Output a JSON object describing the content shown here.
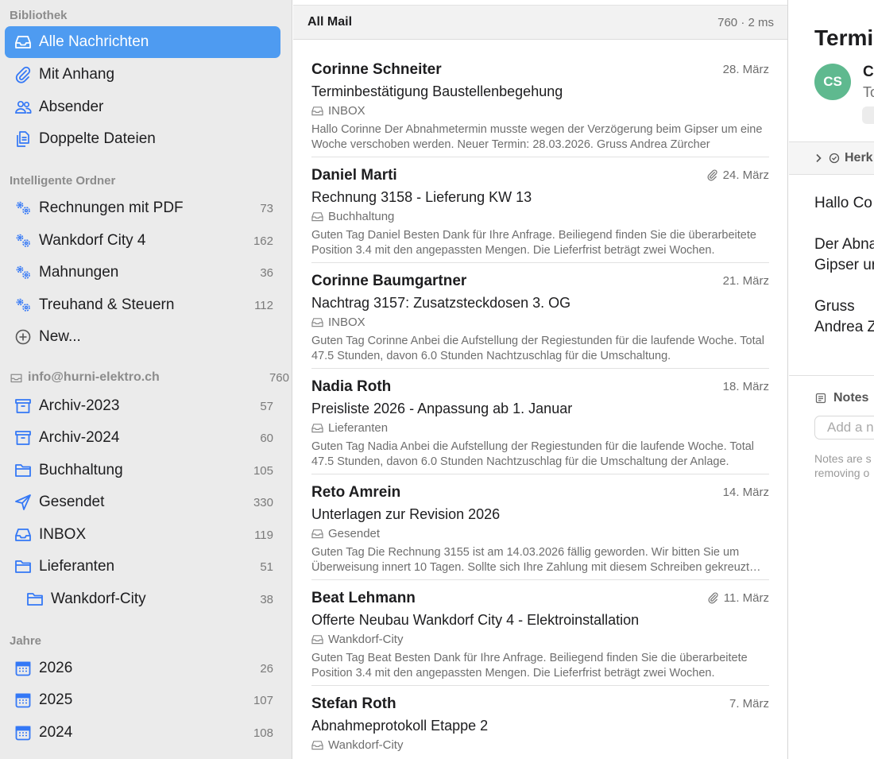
{
  "sidebar": {
    "library_header": "Bibliothek",
    "library": [
      {
        "label": "Alle Nachrichten",
        "icon": "inbox-tray-icon"
      },
      {
        "label": "Mit Anhang",
        "icon": "paperclip-icon"
      },
      {
        "label": "Absender",
        "icon": "people-icon"
      },
      {
        "label": "Doppelte Dateien",
        "icon": "duplicate-files-icon"
      }
    ],
    "smart_header": "Intelligente Ordner",
    "smart": [
      {
        "label": "Rechnungen mit PDF",
        "count": "73",
        "icon": "gears-icon"
      },
      {
        "label": "Wankdorf City 4",
        "count": "162",
        "icon": "gears-icon"
      },
      {
        "label": "Mahnungen",
        "count": "36",
        "icon": "gears-icon"
      },
      {
        "label": "Treuhand & Steuern",
        "count": "112",
        "icon": "gears-icon"
      },
      {
        "label": "New...",
        "icon": "plus-circle-icon"
      }
    ],
    "account": {
      "label": "info@hurni-elektro.ch",
      "count": "760",
      "icon": "tray-icon"
    },
    "folders": [
      {
        "label": "Archiv-2023",
        "count": "57",
        "icon": "archive-box-icon"
      },
      {
        "label": "Archiv-2024",
        "count": "60",
        "icon": "archive-box-icon"
      },
      {
        "label": "Buchhaltung",
        "count": "105",
        "icon": "folder-icon"
      },
      {
        "label": "Gesendet",
        "count": "330",
        "icon": "paper-plane-icon"
      },
      {
        "label": "INBOX",
        "count": "119",
        "icon": "inbox-tray-icon"
      },
      {
        "label": "Lieferanten",
        "count": "51",
        "icon": "folder-icon"
      },
      {
        "label": "Wankdorf-City",
        "count": "38",
        "icon": "folder-icon"
      }
    ],
    "years_header": "Jahre",
    "years": [
      {
        "label": "2026",
        "count": "26",
        "icon": "calendar-icon"
      },
      {
        "label": "2025",
        "count": "107",
        "icon": "calendar-icon"
      },
      {
        "label": "2024",
        "count": "108",
        "icon": "calendar-icon"
      }
    ]
  },
  "list": {
    "title": "All Mail",
    "meta": "760 · 2 ms",
    "messages": [
      {
        "sender": "Corinne Schneiter",
        "date": "28. März",
        "subject": "Terminbestätigung Baustellenbegehung",
        "folder": "INBOX",
        "preview": "Hallo Corinne  Der Abnahmetermin musste wegen der Verzögerung beim Gipser um eine Woche verschoben werden. Neuer Termin: 28.03.2026.  Gruss Andrea Zürcher",
        "attachment": false
      },
      {
        "sender": "Daniel Marti",
        "date": "24. März",
        "subject": "Rechnung 3158 - Lieferung KW 13",
        "folder": "Buchhaltung",
        "preview": "Guten Tag Daniel  Besten Dank für Ihre Anfrage. Beiliegend finden Sie die überarbeitete Position 3.4 mit den angepassten Mengen.  Die Lieferfrist beträgt zwei Wochen.",
        "attachment": true
      },
      {
        "sender": "Corinne Baumgartner",
        "date": "21. März",
        "subject": "Nachtrag 3157: Zusatzsteckdosen 3. OG",
        "folder": "INBOX",
        "preview": "Guten Tag Corinne  Anbei die Aufstellung der Regiestunden für die laufende Woche. Total 47.5 Stunden, davon 6.0 Stunden Nachtzuschlag für die Umschaltung.",
        "attachment": false
      },
      {
        "sender": "Nadia Roth",
        "date": "18. März",
        "subject": "Preisliste 2026 - Anpassung ab 1. Januar",
        "folder": "Lieferanten",
        "preview": "Guten Tag Nadia  Anbei die Aufstellung der Regiestunden für die laufende Woche. Total 47.5 Stunden, davon 6.0 Stunden Nachtzuschlag für die Umschaltung der Anlage.",
        "attachment": false
      },
      {
        "sender": "Reto Amrein",
        "date": "14. März",
        "subject": "Unterlagen zur Revision 2026",
        "folder": "Gesendet",
        "preview": "Guten Tag  Die Rechnung 3155 ist am 14.03.2026 fällig geworden. Wir bitten Sie um Überweisung innert 10 Tagen.  Sollte sich Ihre Zahlung mit diesem Schreiben gekreuzt haben.",
        "attachment": false
      },
      {
        "sender": "Beat Lehmann",
        "date": "11. März",
        "subject": "Offerte Neubau Wankdorf City 4 - Elektroinstallation",
        "folder": "Wankdorf-City",
        "preview": "Guten Tag Beat  Besten Dank für Ihre Anfrage. Beiliegend finden Sie die überarbeitete Position 3.4 mit den angepassten Mengen.  Die Lieferfrist beträgt zwei Wochen.",
        "attachment": true
      },
      {
        "sender": "Stefan Roth",
        "date": "7. März",
        "subject": "Abnahmeprotokoll Etappe 2",
        "folder": "Wankdorf-City",
        "preview": "",
        "attachment": false
      }
    ]
  },
  "reader": {
    "title": "Termin",
    "avatar_initials": "CS",
    "avatar_color": "#5fb98f",
    "from": "C",
    "to": "To",
    "origin_label": "Herk",
    "body_lines": [
      "Hallo Co",
      "Der Abna",
      "Gipser ur",
      "Gruss",
      "Andrea Z"
    ],
    "notes_label": "Notes",
    "notes_placeholder": "Add a n",
    "notes_hint_1": "Notes are s",
    "notes_hint_2": "removing o"
  },
  "colors": {
    "accent": "#4e9bf1",
    "sidebar_bg": "#ebebeb"
  }
}
